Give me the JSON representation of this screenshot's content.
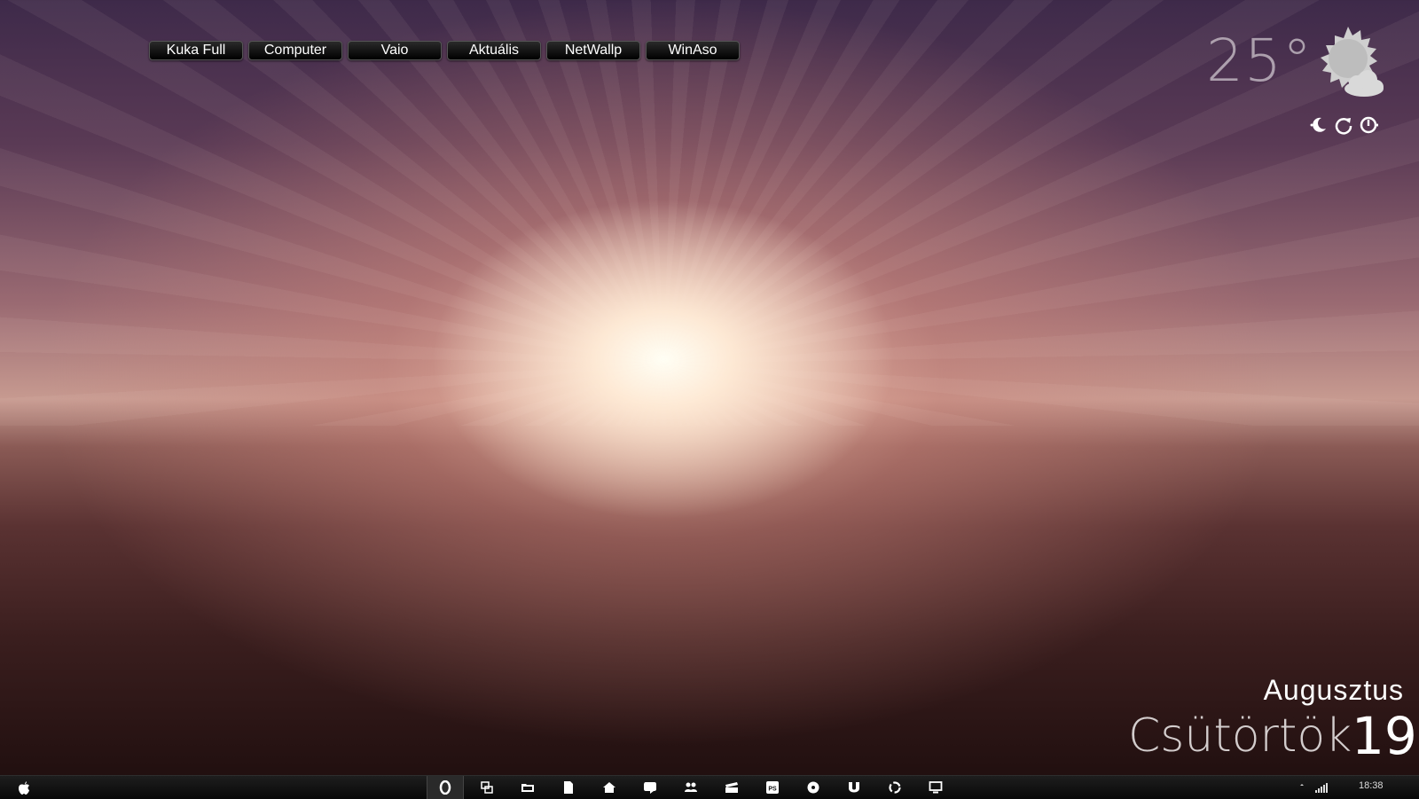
{
  "shortcuts": [
    {
      "label": "Kuka Full"
    },
    {
      "label": "Computer"
    },
    {
      "label": "Vaio"
    },
    {
      "label": "Aktuális"
    },
    {
      "label": "NetWallp"
    },
    {
      "label": "WinAso"
    }
  ],
  "weather": {
    "temperature": "25°",
    "condition_icon": "sun-cloud-icon"
  },
  "system_buttons": [
    "sleep-icon",
    "restart-icon",
    "power-icon"
  ],
  "date": {
    "month": "Augusztus",
    "weekday": "Csütörtök",
    "day": "19"
  },
  "taskbar": {
    "start_icon": "apple-icon",
    "apps": [
      {
        "icon": "opera-icon",
        "active": true
      },
      {
        "icon": "windows-switch-icon"
      },
      {
        "icon": "folder-icon"
      },
      {
        "icon": "document-icon"
      },
      {
        "icon": "home-icon"
      },
      {
        "icon": "chat-icon"
      },
      {
        "icon": "contacts-icon"
      },
      {
        "icon": "clapper-icon"
      },
      {
        "icon": "photoshop-icon",
        "text": "PS"
      },
      {
        "icon": "media-player-icon"
      },
      {
        "icon": "utorrent-icon"
      },
      {
        "icon": "sync-icon"
      },
      {
        "icon": "display-icon"
      }
    ],
    "clock": "18:38"
  }
}
